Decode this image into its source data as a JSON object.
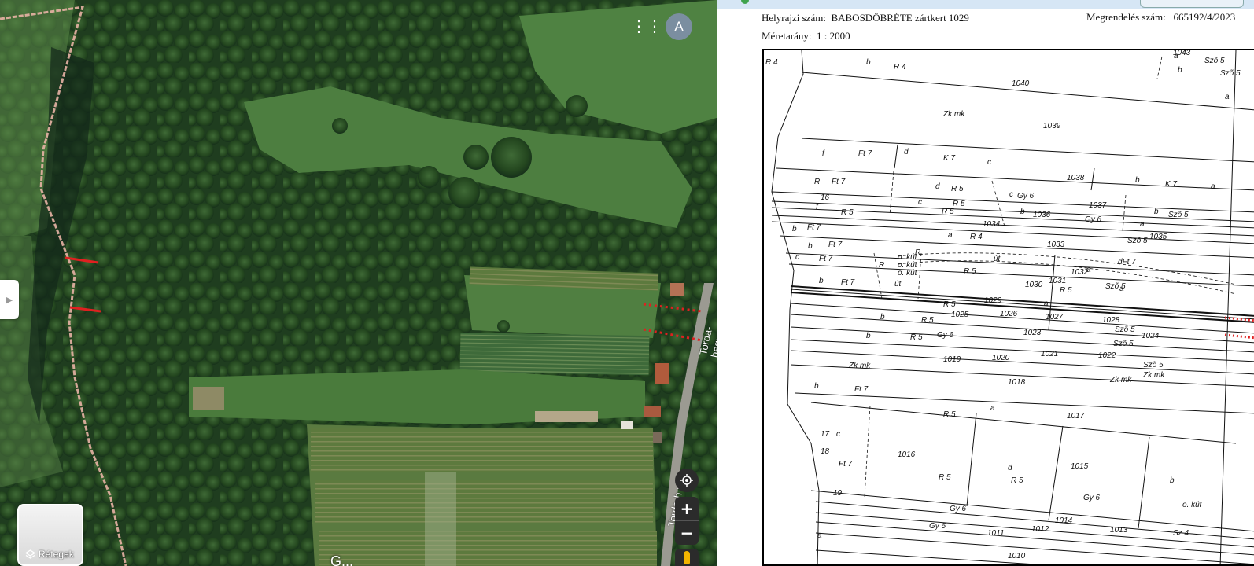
{
  "map": {
    "road_label_1": "Torda-hegy",
    "road_label_2": "Torda-h u.",
    "partial_label": "G...",
    "layers_label": "Rétegek",
    "account_initial": "A",
    "icons": {
      "apps": "apps-grid-icon",
      "layers": "layers-icon",
      "locate": "my-location-icon",
      "zoom_in": "plus-icon",
      "zoom_out": "minus-icon",
      "pegman": "street-view-pegman-icon",
      "side_panel": "chevron-right-icon"
    },
    "colors": {
      "boundary": "#e8b3a5",
      "markers": "#e02020"
    }
  },
  "document": {
    "parcel_label": "Helyrajzi szám",
    "parcel_value": "BABOSDÖBRÉTE zártkert 1029",
    "scale_label": "Méretarány",
    "scale_value": "1 : 2000",
    "order_label": "Megrendelés szám",
    "order_value": "665192/4/2023",
    "plan_labels": [
      {
        "id": "p1043",
        "text": "1043"
      },
      {
        "id": "p1040",
        "text": "1040"
      },
      {
        "id": "p1039",
        "text": "1039"
      },
      {
        "id": "p1038",
        "text": "1038"
      },
      {
        "id": "p1037",
        "text": "1037"
      },
      {
        "id": "p1036",
        "text": "1036"
      },
      {
        "id": "p1035",
        "text": "1035"
      },
      {
        "id": "p1034",
        "text": "1034"
      },
      {
        "id": "p1033",
        "text": "1033"
      },
      {
        "id": "p1032",
        "text": "1032"
      },
      {
        "id": "p1031",
        "text": "1031"
      },
      {
        "id": "p1030",
        "text": "1030"
      },
      {
        "id": "p1029",
        "text": "1029"
      },
      {
        "id": "p1028",
        "text": "1028"
      },
      {
        "id": "p1027",
        "text": "1027"
      },
      {
        "id": "p1026",
        "text": "1026"
      },
      {
        "id": "p1025",
        "text": "1025"
      },
      {
        "id": "p1024",
        "text": "1024"
      },
      {
        "id": "p1023",
        "text": "1023"
      },
      {
        "id": "p1022",
        "text": "1022"
      },
      {
        "id": "p1021",
        "text": "1021"
      },
      {
        "id": "p1020",
        "text": "1020"
      },
      {
        "id": "p1019",
        "text": "1019"
      },
      {
        "id": "p1018",
        "text": "1018"
      },
      {
        "id": "p1017",
        "text": "1017"
      },
      {
        "id": "p1016",
        "text": "1016"
      },
      {
        "id": "p1015",
        "text": "1015"
      },
      {
        "id": "p1014",
        "text": "1014"
      },
      {
        "id": "p1013",
        "text": "1013"
      },
      {
        "id": "p1012",
        "text": "1012"
      },
      {
        "id": "p1011",
        "text": "1011"
      },
      {
        "id": "p1010",
        "text": "1010"
      },
      {
        "id": "r4a",
        "text": "R 4"
      },
      {
        "id": "r4b",
        "text": "R 4"
      },
      {
        "id": "r4c",
        "text": "R 4"
      },
      {
        "id": "zk1",
        "text": "Zk mk"
      },
      {
        "id": "zk2",
        "text": "Zk mk"
      },
      {
        "id": "zk3",
        "text": "Zk mk"
      },
      {
        "id": "zk4",
        "text": "Zk mk"
      },
      {
        "id": "ft7a",
        "text": "Ft 7"
      },
      {
        "id": "ft7b",
        "text": "Ft 7"
      },
      {
        "id": "ft7c",
        "text": "Ft 7"
      },
      {
        "id": "ft7d",
        "text": "Ft 7"
      },
      {
        "id": "ft7e",
        "text": "Ft 7"
      },
      {
        "id": "ft7f",
        "text": "Ft 7"
      },
      {
        "id": "ft7g",
        "text": "Ft 7"
      },
      {
        "id": "ft7h",
        "text": "Ft 7"
      },
      {
        "id": "k7a",
        "text": "K 7"
      },
      {
        "id": "k7b",
        "text": "K 7"
      },
      {
        "id": "r5a",
        "text": "R 5"
      },
      {
        "id": "r5b",
        "text": "R 5"
      },
      {
        "id": "r5c",
        "text": "R 5"
      },
      {
        "id": "r5d",
        "text": "R 5"
      },
      {
        "id": "r5e",
        "text": "R 5"
      },
      {
        "id": "r5f",
        "text": "R 5"
      },
      {
        "id": "r5g",
        "text": "R 5"
      },
      {
        "id": "r5h",
        "text": "R 5"
      },
      {
        "id": "r5i",
        "text": "R 5"
      },
      {
        "id": "r5j",
        "text": "R 5"
      },
      {
        "id": "r5k",
        "text": "R 5"
      },
      {
        "id": "r5l",
        "text": "R 5"
      },
      {
        "id": "gy6a",
        "text": "Gy 6"
      },
      {
        "id": "gy6b",
        "text": "Gy 6"
      },
      {
        "id": "gy6c",
        "text": "Gy 6"
      },
      {
        "id": "gy6d",
        "text": "Gy 6"
      },
      {
        "id": "gy6e",
        "text": "Gy 6"
      },
      {
        "id": "gy6f",
        "text": "Gy 6"
      },
      {
        "id": "sz5a",
        "text": "Szõ 5"
      },
      {
        "id": "sz5b",
        "text": "Szõ 5"
      },
      {
        "id": "sz5c",
        "text": "Szõ 5"
      },
      {
        "id": "sz5d",
        "text": "Szõ 5"
      },
      {
        "id": "sz5e",
        "text": "Szõ 5"
      },
      {
        "id": "sz5f",
        "text": "Szõ 5"
      },
      {
        "id": "sz5g",
        "text": "Szõ 5"
      },
      {
        "id": "sz5h",
        "text": "Szõ 5"
      },
      {
        "id": "sz4",
        "text": "Sz 4"
      },
      {
        "id": "ok1",
        "text": "o. kút"
      },
      {
        "id": "ok2",
        "text": "o. kút"
      },
      {
        "id": "ok3",
        "text": "o. kút"
      },
      {
        "id": "ok4",
        "text": "o. kút"
      },
      {
        "id": "ut1",
        "text": "út"
      },
      {
        "id": "ut2",
        "text": "út"
      },
      {
        "id": "dft7",
        "text": "dFt 7"
      },
      {
        "id": "n16",
        "text": "16"
      },
      {
        "id": "n17",
        "text": "17"
      },
      {
        "id": "n18",
        "text": "18"
      },
      {
        "id": "n19",
        "text": "19"
      },
      {
        "id": "la1",
        "text": "a"
      },
      {
        "id": "la2",
        "text": "a"
      },
      {
        "id": "la3",
        "text": "a"
      },
      {
        "id": "la4",
        "text": "a"
      },
      {
        "id": "la5",
        "text": "a"
      },
      {
        "id": "la6",
        "text": "a"
      },
      {
        "id": "la7",
        "text": "a"
      },
      {
        "id": "la8",
        "text": "a"
      },
      {
        "id": "la9",
        "text": "a"
      },
      {
        "id": "la10",
        "text": "a"
      },
      {
        "id": "lb1",
        "text": "b"
      },
      {
        "id": "lb2",
        "text": "b"
      },
      {
        "id": "lb3",
        "text": "b"
      },
      {
        "id": "lb4",
        "text": "b"
      },
      {
        "id": "lb5",
        "text": "b"
      },
      {
        "id": "lb6",
        "text": "b"
      },
      {
        "id": "lb7",
        "text": "b"
      },
      {
        "id": "lb8",
        "text": "b"
      },
      {
        "id": "lb9",
        "text": "b"
      },
      {
        "id": "lb10",
        "text": "b"
      },
      {
        "id": "lb11",
        "text": "b"
      },
      {
        "id": "lb12",
        "text": "b"
      },
      {
        "id": "lc1",
        "text": "c"
      },
      {
        "id": "lc2",
        "text": "c"
      },
      {
        "id": "lc3",
        "text": "c"
      },
      {
        "id": "lc4",
        "text": "c"
      },
      {
        "id": "lc5",
        "text": "c"
      },
      {
        "id": "ld1",
        "text": "d"
      },
      {
        "id": "ld2",
        "text": "d"
      },
      {
        "id": "ld3",
        "text": "d"
      },
      {
        "id": "lf1",
        "text": "f"
      },
      {
        "id": "lf2",
        "text": "f"
      },
      {
        "id": "lr1",
        "text": "R"
      },
      {
        "id": "lr2",
        "text": "R"
      },
      {
        "id": "lr3",
        "text": "R"
      }
    ]
  }
}
